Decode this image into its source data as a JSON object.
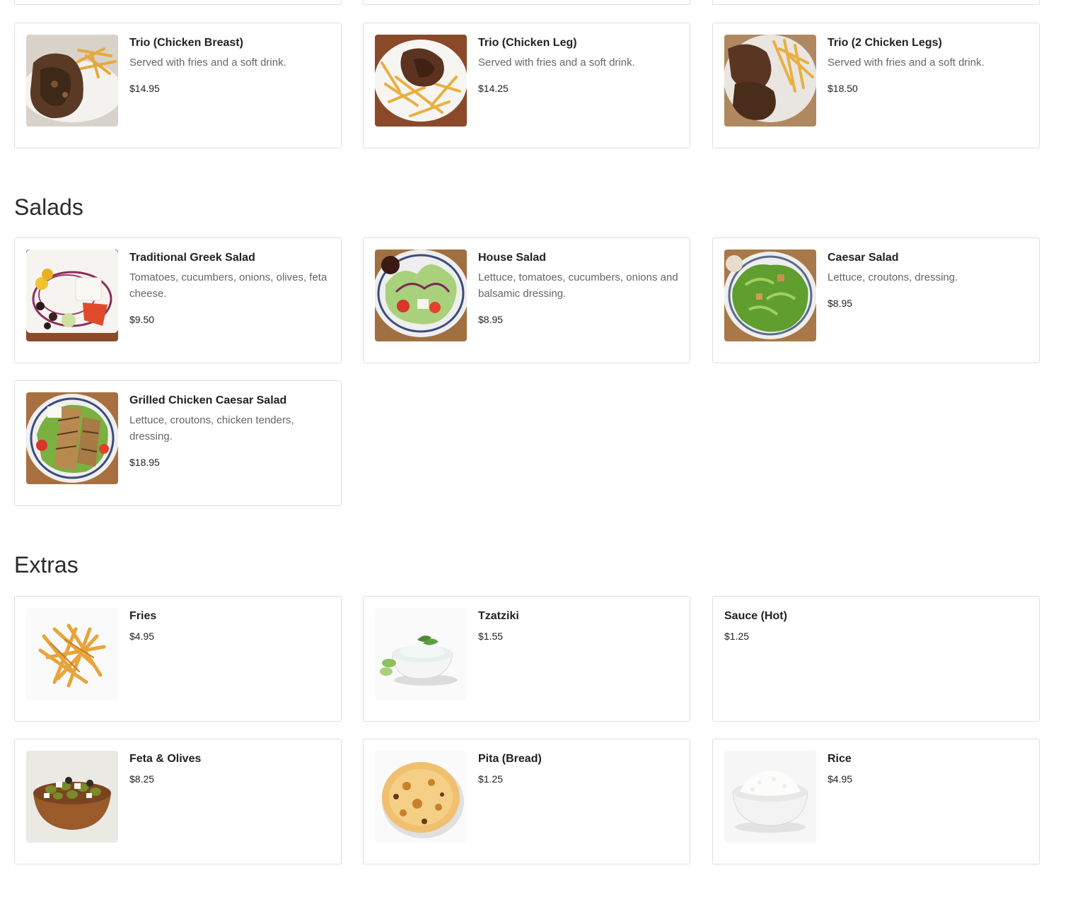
{
  "partial_row": [
    {
      "id": "partial-1"
    },
    {
      "id": "partial-2"
    },
    {
      "id": "partial-3"
    }
  ],
  "sections": {
    "chicken": {
      "items": [
        {
          "name": "Trio (Chicken Breast)",
          "desc": "Served with fries and a soft drink.",
          "price": "$14.95",
          "image": "chicken-breast-plate-image"
        },
        {
          "name": "Trio (Chicken Leg)",
          "desc": "Served with fries and a soft drink.",
          "price": "$14.25",
          "image": "chicken-leg-plate-image"
        },
        {
          "name": "Trio (2 Chicken Legs)",
          "desc": "Served with fries and a soft drink.",
          "price": "$18.50",
          "image": "two-chicken-legs-plate-image"
        }
      ]
    },
    "salads": {
      "title": "Salads",
      "items": [
        {
          "name": "Traditional Greek Salad",
          "desc": "Tomatoes, cucumbers, onions, olives, feta cheese.",
          "price": "$9.50",
          "image": "greek-salad-image"
        },
        {
          "name": "House Salad",
          "desc": "Lettuce, tomatoes, cucumbers, onions and balsamic dressing.",
          "price": "$8.95",
          "image": "house-salad-image"
        },
        {
          "name": "Caesar Salad",
          "desc": "Lettuce, croutons, dressing.",
          "price": "$8.95",
          "image": "caesar-salad-image"
        },
        {
          "name": "Grilled Chicken Caesar Salad",
          "desc": "Lettuce, croutons, chicken tenders, dressing.",
          "price": "$18.95",
          "image": "grilled-chicken-caesar-salad-image"
        }
      ]
    },
    "extras": {
      "title": "Extras",
      "items": [
        {
          "name": "Fries",
          "price": "$4.95",
          "image": "fries-image"
        },
        {
          "name": "Tzatziki",
          "price": "$1.55",
          "image": "tzatziki-image"
        },
        {
          "name": "Sauce (Hot)",
          "price": "$1.25"
        },
        {
          "name": "Feta & Olives",
          "price": "$8.25",
          "image": "feta-olives-image"
        },
        {
          "name": "Pita (Bread)",
          "price": "$1.25",
          "image": "pita-bread-image"
        },
        {
          "name": "Rice",
          "price": "$4.95",
          "image": "rice-bowl-image"
        }
      ]
    }
  },
  "colors": {
    "card_border": "#dedede",
    "title": "#2a2a2a",
    "desc": "#666666",
    "text": "#222222"
  }
}
